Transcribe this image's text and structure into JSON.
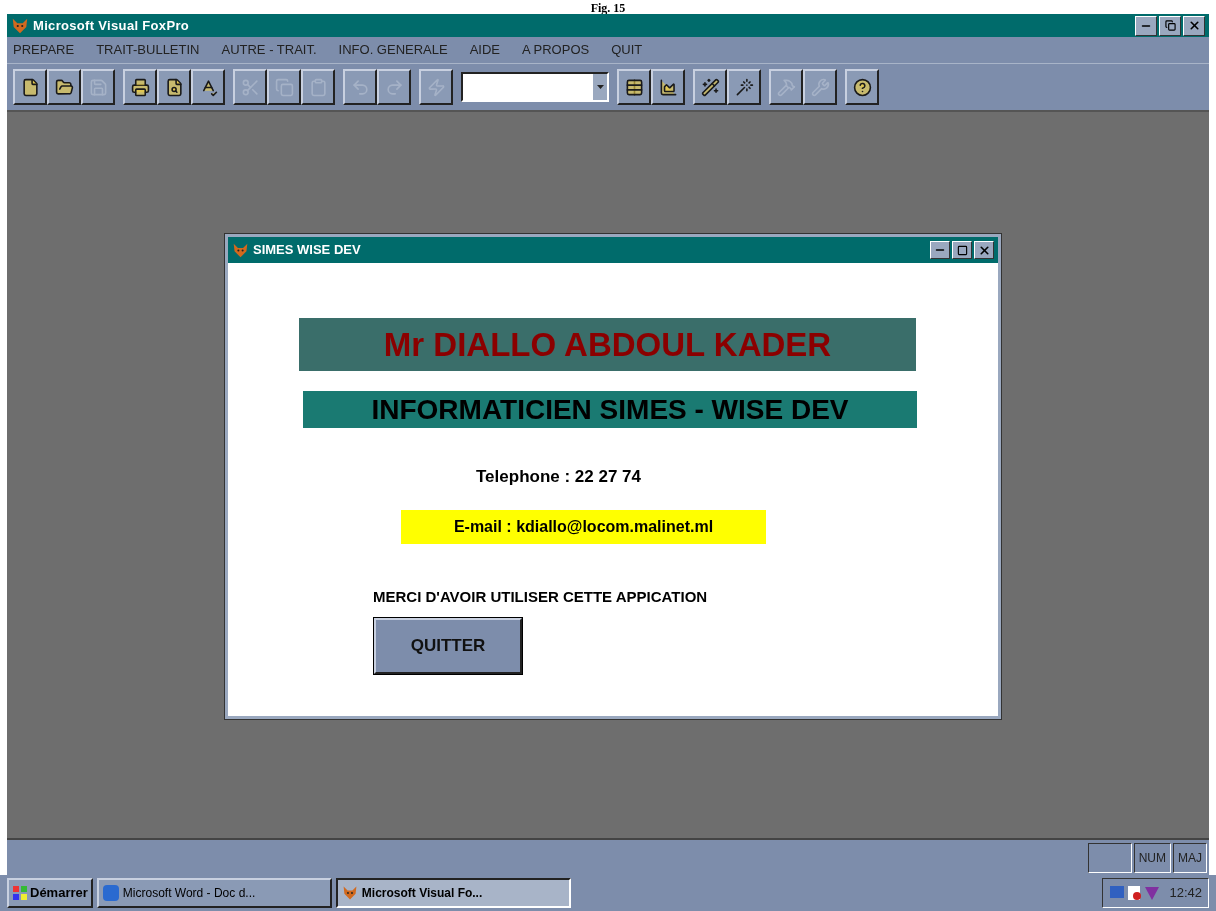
{
  "caption": "Fig. 15",
  "window": {
    "title": "Microsoft Visual FoxPro"
  },
  "menu": [
    "PREPARE",
    "TRAIT-BULLETIN",
    "AUTRE - TRAIT.",
    "INFO. GENERALE",
    "AIDE",
    "A PROPOS",
    "QUIT"
  ],
  "toolbar": [
    [
      {
        "kind": "new",
        "disabled": false
      },
      {
        "kind": "open",
        "disabled": false
      },
      {
        "kind": "save",
        "disabled": true
      }
    ],
    [
      {
        "kind": "print",
        "disabled": false
      },
      {
        "kind": "preview",
        "disabled": false
      },
      {
        "kind": "spell",
        "disabled": false
      }
    ],
    [
      {
        "kind": "cut",
        "disabled": true
      },
      {
        "kind": "copy",
        "disabled": true
      },
      {
        "kind": "paste",
        "disabled": true
      }
    ],
    [
      {
        "kind": "undo",
        "disabled": true
      },
      {
        "kind": "redo",
        "disabled": true
      }
    ],
    [
      {
        "kind": "run",
        "disabled": true
      }
    ],
    [
      {
        "kind": "combo"
      }
    ],
    [
      {
        "kind": "form",
        "disabled": false
      },
      {
        "kind": "report",
        "disabled": false
      }
    ],
    [
      {
        "kind": "wizard",
        "disabled": false
      },
      {
        "kind": "wizard2",
        "disabled": false
      }
    ],
    [
      {
        "kind": "builder",
        "disabled": true
      },
      {
        "kind": "builder2",
        "disabled": true
      }
    ],
    [
      {
        "kind": "help",
        "disabled": false
      }
    ]
  ],
  "dialog": {
    "title": "SIMES WISE DEV",
    "name": "Mr DIALLO ABDOUL KADER",
    "role": "INFORMATICIEN SIMES - WISE DEV",
    "telephone": "Telephone : 22 27 74",
    "email": "E-mail : kdiallo@locom.malinet.ml",
    "thanks": "MERCI D'AVOIR UTILISER CETTE APPICATION",
    "button": "QUITTER"
  },
  "status_bar": {
    "indicators": [
      "NUM",
      "MAJ"
    ]
  },
  "taskbar": {
    "start": "Démarrer",
    "tasks": [
      {
        "label": "Microsoft Word - Doc d...",
        "selected": false
      },
      {
        "label": "Microsoft Visual Fo...",
        "selected": true
      }
    ],
    "clock": "12:42"
  }
}
